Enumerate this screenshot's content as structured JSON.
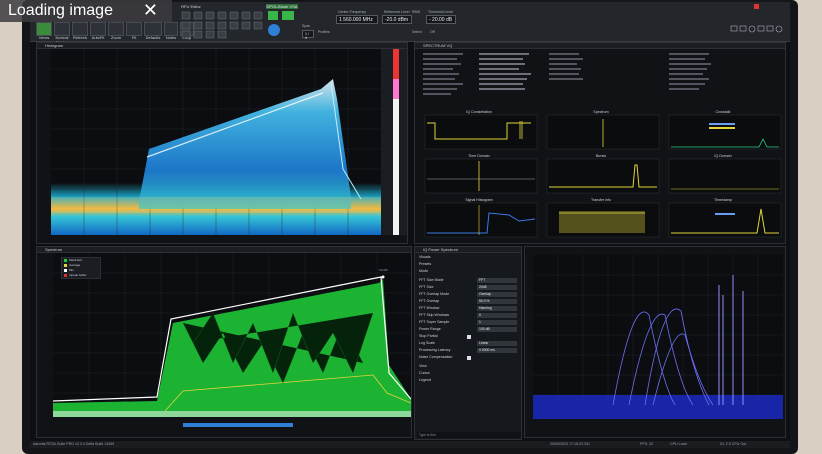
{
  "overlay": {
    "loading_text": "Loading image",
    "close_glyph": "✕"
  },
  "toolbar": {
    "group_label": "RFU Editor",
    "mode_label": "DPOL/Mode VSA",
    "buttons": [
      "Views",
      "Normal Modes",
      "Refresh",
      "AutoFit",
      "Zoom",
      "Fit",
      "Defaults",
      "Notes",
      "Help"
    ],
    "span_label": "Span",
    "span_value": "1 / 4",
    "profile_label": "Profiles",
    "center_freq_label": "Center Frequency",
    "center_freq_value": "1 560.000 MHz",
    "ref_level_label": "Reference Level",
    "ref_level_value": "-20.0 dBm",
    "threshold_label": "Threshold Level",
    "threshold_value": "- 20.00 dB",
    "rbw_label": "RBW",
    "mode_select": "Select",
    "off_label": "Off",
    "colors": {
      "ribbon": "#23262b",
      "accent_green": "#3ab54a",
      "accent_blue": "#2f7fd6"
    }
  },
  "panels": {
    "histogram": {
      "title": "Histogram"
    },
    "spectrum_vq": {
      "title": "SPECTRUM VQ"
    },
    "spectrum": {
      "title": "Spectrum"
    },
    "power_spectrum": {
      "title": "IQ Power Spectrum"
    }
  },
  "mini_charts": [
    {
      "title": "IQ Constellation"
    },
    {
      "title": "Spectrum"
    },
    {
      "title": "Crosstalk"
    },
    {
      "title": "Time Domain"
    },
    {
      "title": "Bursts"
    },
    {
      "title": "IQ Domain"
    },
    {
      "title": "Signal Histogram"
    },
    {
      "title": "Transfer info"
    },
    {
      "title": "Timestamp"
    }
  ],
  "settings": {
    "sections": [
      "Visuals",
      "Presets",
      "Mode"
    ],
    "rows": [
      {
        "label": "FFT Size Mode",
        "value": "FFT"
      },
      {
        "label": "FFT Size",
        "value": "2048"
      },
      {
        "label": "FFT Overlap Mode",
        "value": "Overlap"
      },
      {
        "label": "FFT Overlap",
        "value": "50.0 %"
      },
      {
        "label": "FFT Window",
        "value": "Hanning"
      },
      {
        "label": "FFT Skip Windows",
        "value": "0"
      },
      {
        "label": "FFT Super Sample",
        "value": "1"
      },
      {
        "label": "Power Range",
        "value": "100 dB"
      },
      {
        "label": "Stop Partial",
        "value": ""
      },
      {
        "label": "Log Scale",
        "value": "Linear"
      },
      {
        "label": "Processing Latency",
        "value": "0.0000 ms"
      },
      {
        "label": "Noise Compensation",
        "value": ""
      }
    ],
    "footer_sections": [
      "View",
      "Cursor",
      "Legend"
    ],
    "tip_label": "Type to find"
  },
  "spectrum_legend": [
    "Max/Hold",
    "Average",
    "Min",
    "Inpeak buffer"
  ],
  "spectrum_marker": "M1dBr",
  "status": {
    "left": "Aaronia RTSA-Suite PRO v2.2.4 Delta Build 13459",
    "right_date": "20/09/2023 17:15:23.331",
    "fps": "FPS: 22",
    "cpu": "CPU Load",
    "extra": "IO: 2.5  CPU Out"
  }
}
